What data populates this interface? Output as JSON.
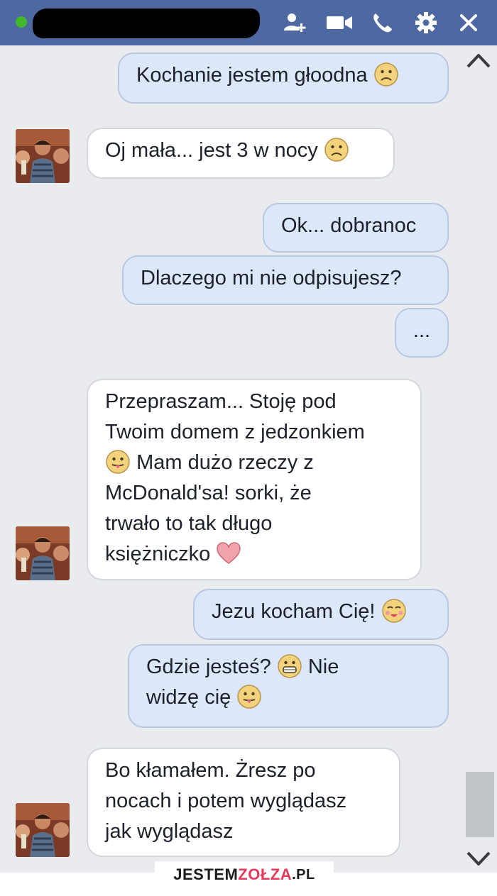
{
  "header": {
    "status": "online",
    "icons": [
      "add-friend-icon",
      "video-call-icon",
      "phone-icon",
      "gear-icon",
      "close-icon"
    ],
    "bg_color": "#4e69a2"
  },
  "messages": [
    {
      "from": "me",
      "text": "Kochanie jestem głoodna",
      "emoji_end": "frown-emoji"
    },
    {
      "from": "other",
      "text": "Oj mała... jest 3 w nocy",
      "emoji_end": "frown-emoji"
    },
    {
      "from": "me",
      "text": "Ok... dobranoc"
    },
    {
      "from": "me",
      "text": "Dlaczego mi nie odpisujesz?"
    },
    {
      "from": "me",
      "text": "..."
    },
    {
      "from": "other",
      "line1": "Przepraszam... Stoję pod",
      "line2": "Twoim domem z jedzonkiem",
      "line3": "Mam dużo rzeczy z",
      "line4": "McDonald'sa! sorki, że",
      "line5": "trwało to tak długo",
      "line6": "księżniczko",
      "emojis": [
        "tongue-emoji",
        "heart-emoji"
      ]
    },
    {
      "from": "me",
      "text": "Jezu kocham Cię!",
      "emoji_end": "kiss-emoji"
    },
    {
      "from": "me",
      "line1a": "Gdzie jesteś?",
      "line1b": "Nie",
      "line2": "widzę cię",
      "emojis": [
        "grin-emoji",
        "tongue-emoji"
      ]
    },
    {
      "from": "other",
      "line1": "Bo kłamałem. Żresz po",
      "line2": "nocach i potem wyglądasz",
      "line3": "jak wyglądasz"
    }
  ],
  "watermark": {
    "part1": "JESTEM",
    "part2": "ZOŁZA",
    "part3": ".PL"
  },
  "colors": {
    "sent_bubble": "#dce8fa",
    "recv_bubble": "#ffffff",
    "chat_bg": "#e9ebee",
    "online": "#42b72a"
  }
}
